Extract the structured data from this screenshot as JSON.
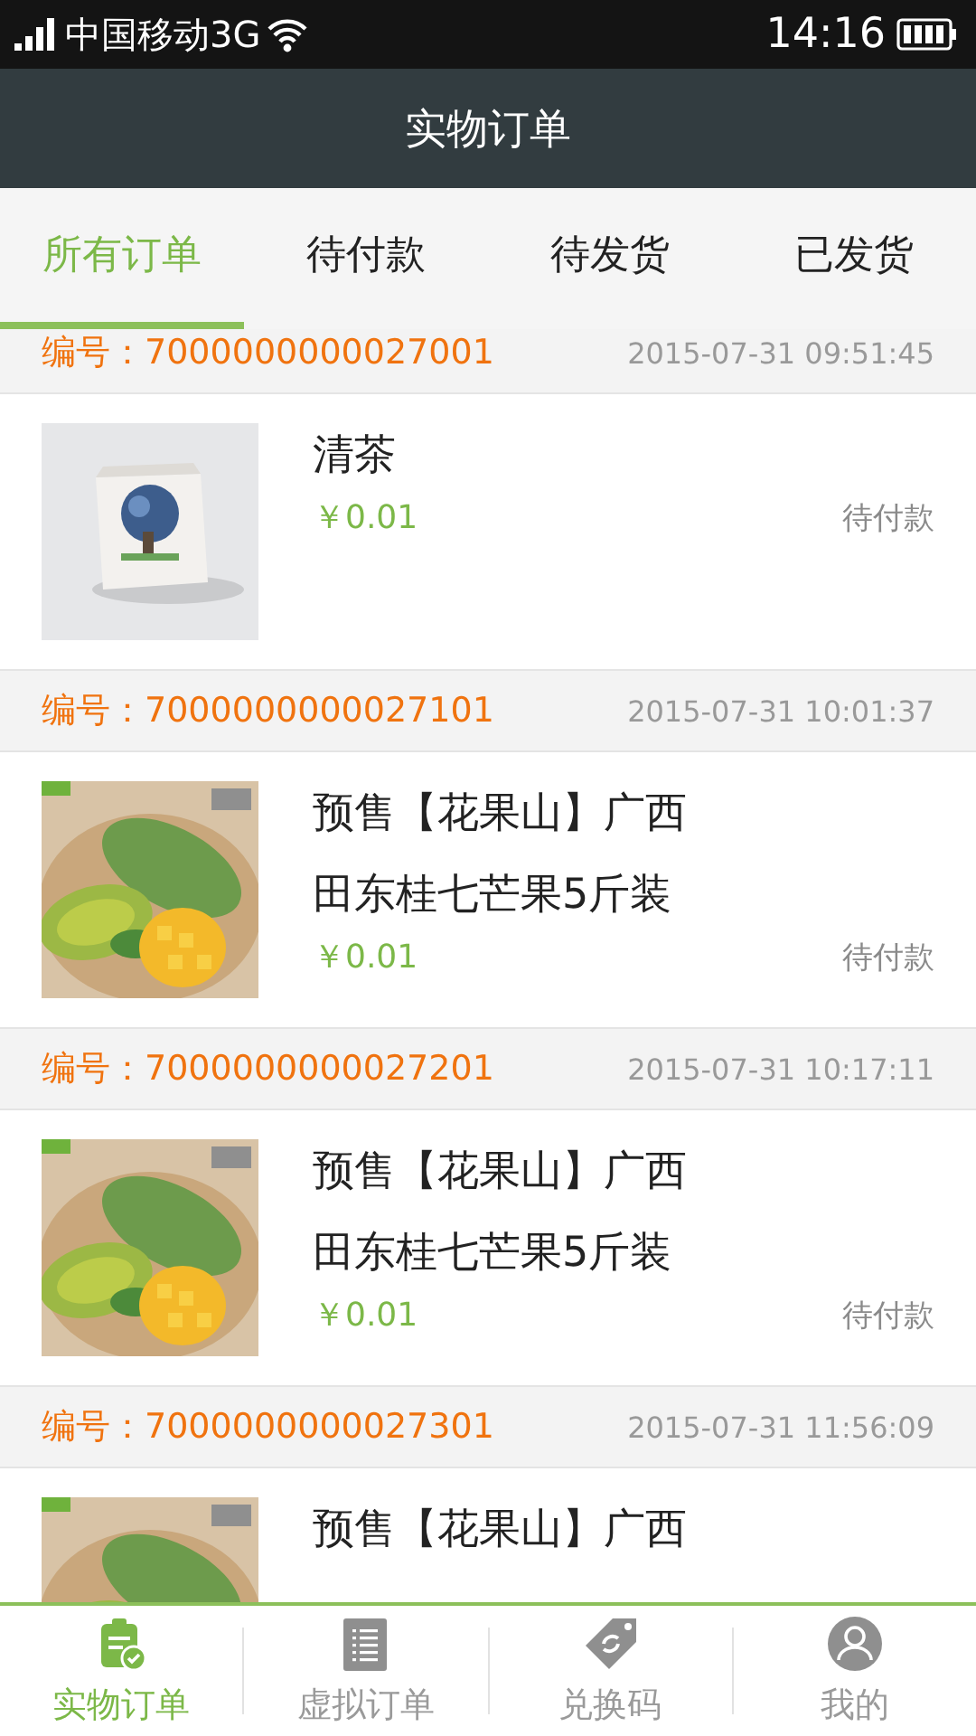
{
  "status_bar": {
    "carrier": "中国移动3G",
    "time": "14:16"
  },
  "header": {
    "title": "实物订单"
  },
  "tabs": [
    {
      "label": "所有订单",
      "selected": true
    },
    {
      "label": "待付款",
      "selected": false
    },
    {
      "label": "待发货",
      "selected": false
    },
    {
      "label": "已发货",
      "selected": false
    }
  ],
  "orders": [
    {
      "number_label": "编号：",
      "number": "7000000000027001",
      "time": "2015-07-31 09:51:45",
      "product": {
        "kind": "tea",
        "name": "清茶",
        "price": "￥0.01",
        "status": "待付款"
      }
    },
    {
      "number_label": "编号：",
      "number": "7000000000027101",
      "time": "2015-07-31 10:01:37",
      "product": {
        "kind": "mango",
        "name": "预售【花果山】广西田东桂七芒果5斤装",
        "price": "￥0.01",
        "status": "待付款"
      }
    },
    {
      "number_label": "编号：",
      "number": "7000000000027201",
      "time": "2015-07-31 10:17:11",
      "product": {
        "kind": "mango",
        "name": "预售【花果山】广西田东桂七芒果5斤装",
        "price": "￥0.01",
        "status": "待付款"
      }
    },
    {
      "number_label": "编号：",
      "number": "7000000000027301",
      "time": "2015-07-31 11:56:09",
      "product": {
        "kind": "mango",
        "name": "预售【花果山】广西"
      }
    }
  ],
  "bottom_nav": [
    {
      "kind": "clipboard",
      "label": "实物订单",
      "selected": true
    },
    {
      "kind": "list",
      "label": "虚拟订单",
      "selected": false
    },
    {
      "kind": "tag",
      "label": "兑换码",
      "selected": false
    },
    {
      "kind": "user",
      "label": "我的",
      "selected": false
    }
  ]
}
